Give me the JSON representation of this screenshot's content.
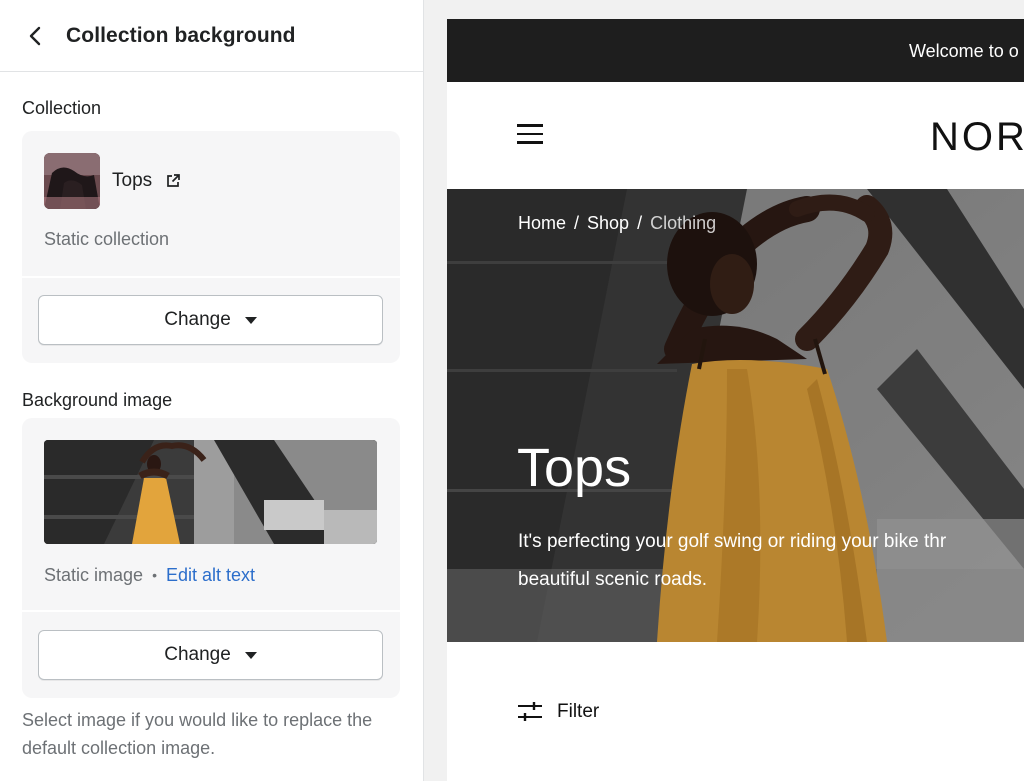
{
  "panel": {
    "title": "Collection background",
    "collection_label": "Collection",
    "collection": {
      "name": "Tops",
      "type": "Static collection",
      "change_label": "Change"
    },
    "background_label": "Background image",
    "background": {
      "type": "Static image",
      "separator": "•",
      "edit_alt_label": "Edit alt text",
      "change_label": "Change"
    },
    "help_text": "Select image if you would like to replace the default collection image.",
    "icons": {
      "back": "chevron-left-icon",
      "external": "external-link-icon",
      "caret": "caret-down-icon"
    }
  },
  "preview": {
    "announcement": "Welcome to o",
    "logo": "NOR",
    "breadcrumbs": [
      "Home",
      "Shop",
      "Clothing"
    ],
    "breadcrumb_separator": "/",
    "hero_title": "Tops",
    "hero_desc_line1": "It's perfecting your golf swing or riding your bike thr",
    "hero_desc_line2": "beautiful scenic roads.",
    "filter_label": "Filter",
    "icons": {
      "menu": "hamburger-menu-icon",
      "filter": "filter-sliders-icon"
    }
  },
  "colors": {
    "link": "#2c6ecb",
    "announcement_bg": "#1e1e1e",
    "card_bg": "#f6f6f7",
    "dress_yellow": "#e2a43c"
  }
}
